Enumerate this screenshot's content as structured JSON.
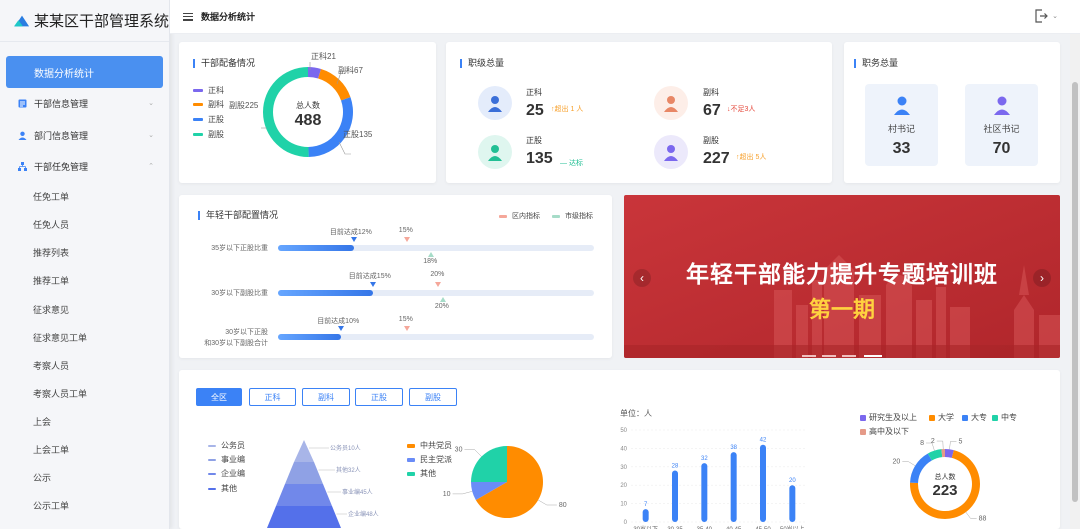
{
  "app": {
    "title": "某某区干部管理系统"
  },
  "header": {
    "page_title": "数据分析统计"
  },
  "sidebar": {
    "active": "数据分析统计",
    "groups": [
      {
        "label": "干部信息管理",
        "icon": "document-icon"
      },
      {
        "label": "部门信息管理",
        "icon": "user-icon"
      },
      {
        "label": "干部任免管理",
        "icon": "org-chart-icon"
      }
    ],
    "sub_items": [
      "任免工单",
      "任免人员",
      "推荐列表",
      "推荐工单",
      "征求意见",
      "征求意见工单",
      "考察人员",
      "考察人员工单",
      "上会",
      "上会工单",
      "公示",
      "公示工单"
    ]
  },
  "cadre_config": {
    "title": "干部配备情况",
    "center_label": "总人数",
    "total": "488",
    "legend": [
      "正科",
      "副科",
      "正股",
      "副股"
    ],
    "colors": [
      "#7b68ee",
      "#ff8c00",
      "#3b82f6",
      "#20d2a8"
    ],
    "callouts": [
      "正科21",
      "副科67",
      "副股225",
      "正股135"
    ]
  },
  "rank_total": {
    "title": "职级总量",
    "items": [
      {
        "name": "正科",
        "value": "25",
        "delta": "超出 1 人",
        "dir": "up"
      },
      {
        "name": "副科",
        "value": "67",
        "delta": "不足3人",
        "dir": "down"
      },
      {
        "name": "正股",
        "value": "135",
        "delta": "达标",
        "dir": "flat"
      },
      {
        "name": "副股",
        "value": "227",
        "delta": "超出 5人",
        "dir": "up"
      }
    ]
  },
  "post_total": {
    "title": "职务总量",
    "items": [
      {
        "name": "村书记",
        "value": "33"
      },
      {
        "name": "社区书记",
        "value": "70"
      }
    ]
  },
  "young_cadre": {
    "title": "年轻干部配置情况",
    "legend": [
      "区内指标",
      "市级指标"
    ],
    "rows": [
      {
        "label": "35岁以下正股比重",
        "current_text": "目前达成12%",
        "current": 0.12,
        "district_text": "15%",
        "district": 0.15,
        "city_text": "18%",
        "city": 0.18
      },
      {
        "label": "30岁以下副股比重",
        "current_text": "目前达成15%",
        "current": 0.15,
        "district_text": "20%",
        "district": 0.2,
        "city_text": "20%",
        "city": 0.2
      },
      {
        "label_line1": "30岁以下正股",
        "label_line2": "和30岁以下副股合计",
        "current_text": "目前达成10%",
        "current": 0.1,
        "district_text": "15%",
        "district": 0.15
      }
    ]
  },
  "banner": {
    "headline": "年轻干部能力提升专题培训班",
    "subline": "第一期",
    "prev": "‹",
    "next": "›"
  },
  "tabs": [
    "全区",
    "正科",
    "副科",
    "正股",
    "副股"
  ],
  "chart_data": [
    {
      "type": "funnel",
      "legend": [
        "公务员",
        "事业编",
        "企业编",
        "其他"
      ],
      "labels": [
        "公务员10人",
        "其他32人",
        "事业编45人",
        "企业编48人"
      ],
      "values": [
        10,
        32,
        45,
        48
      ]
    },
    {
      "type": "pie",
      "legend": [
        "中共党员",
        "民主党派",
        "其他"
      ],
      "values": [
        80,
        10,
        30
      ],
      "colors": [
        "#ff8c00",
        "#6a8cf7",
        "#20d2a8"
      ]
    },
    {
      "type": "bar",
      "unit_label": "单位：人",
      "ylim": [
        0,
        50
      ],
      "yticks": [
        "0",
        "10",
        "20",
        "30",
        "40",
        "50"
      ],
      "categories": [
        "30岁以下",
        "30-35",
        "35-40",
        "40-45",
        "45-50",
        "50岁以上"
      ],
      "category_labels": [
        "30岁以下",
        "30-35",
        "35-40",
        "40-45",
        "45-50",
        "50岁以上"
      ],
      "values": [
        7,
        28,
        32,
        38,
        42,
        20
      ]
    },
    {
      "type": "donut",
      "legend": [
        "研究生及以上",
        "大学",
        "大专",
        "中专",
        "高中及以下"
      ],
      "colors": [
        "#7b68ee",
        "#ff8c00",
        "#3b82f6",
        "#20d2a8",
        "#e59a88"
      ],
      "values": [
        5,
        88,
        20,
        8,
        2
      ],
      "center_label": "总人数",
      "total": "223"
    }
  ]
}
